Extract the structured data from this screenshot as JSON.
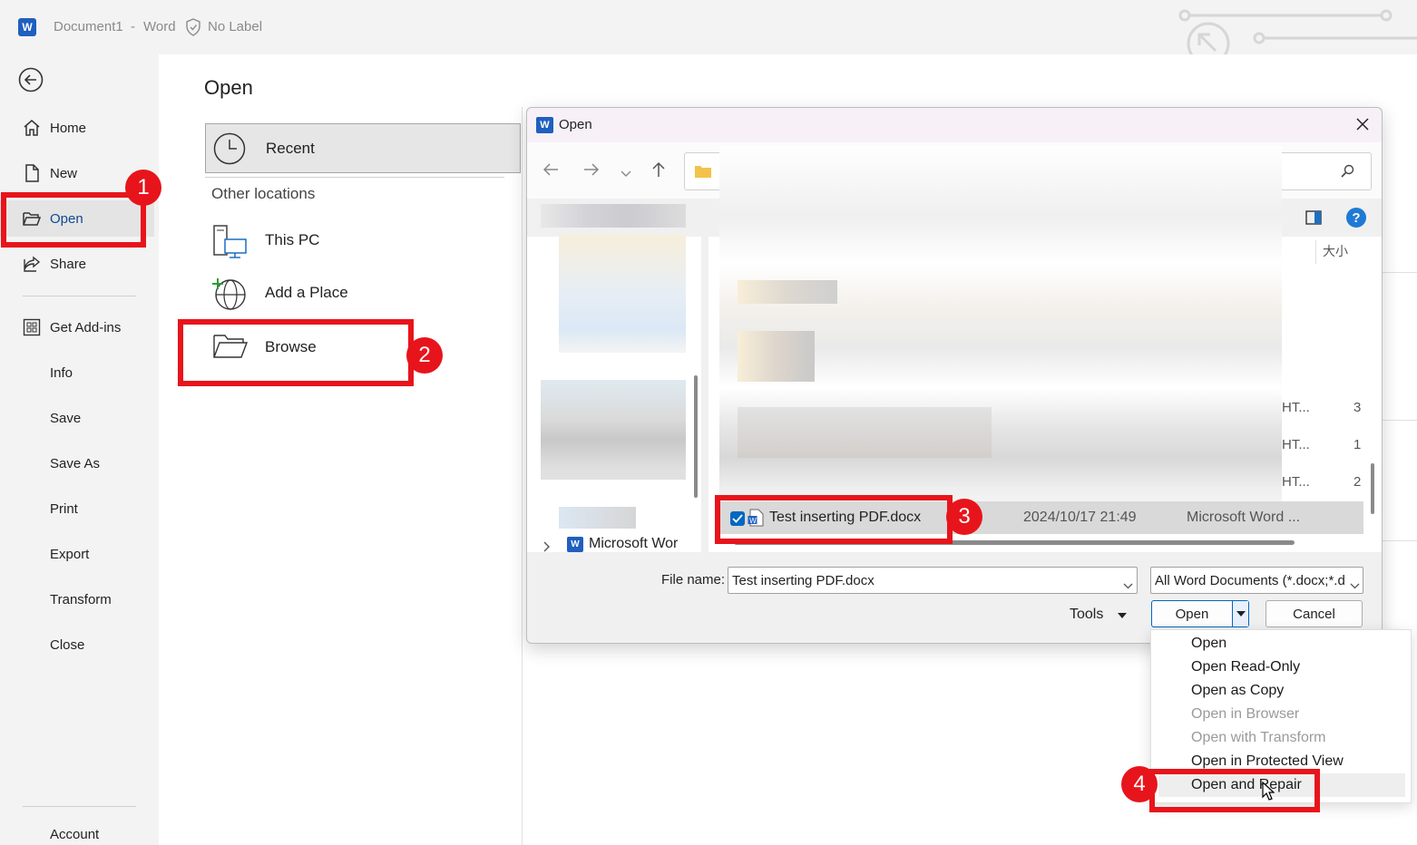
{
  "titlebar": {
    "app_icon": "W",
    "document": "Document1",
    "dash": "-",
    "app": "Word",
    "label": "No Label"
  },
  "nav": {
    "home": "Home",
    "new": "New",
    "open": "Open",
    "share": "Share",
    "addins": "Get Add-ins",
    "info": "Info",
    "save": "Save",
    "save_as": "Save As",
    "print": "Print",
    "export": "Export",
    "transform": "Transform",
    "close": "Close",
    "account": "Account"
  },
  "open_panel": {
    "title": "Open",
    "recent": "Recent",
    "other_locations": "Other locations",
    "this_pc": "This PC",
    "add_place": "Add a Place",
    "browse": "Browse"
  },
  "dialog": {
    "title": "Open",
    "column_size": "大小",
    "tree_item": "Microsoft Wor",
    "partial_type": [
      "HT...",
      "HT...",
      "HT..."
    ],
    "partial_size": [
      "3",
      "1",
      "2"
    ],
    "selected_file": {
      "name": "Test inserting PDF.docx",
      "date": "2024/10/17 21:49",
      "type": "Microsoft Word ..."
    },
    "file_name_label": "File name:",
    "file_name_value": "Test inserting PDF.docx",
    "filter_value": "All Word Documents (*.docx;*.d",
    "tools": "Tools",
    "open_button": "Open",
    "cancel_button": "Cancel"
  },
  "open_menu": {
    "items": [
      "Open",
      "Open Read-Only",
      "Open as Copy",
      "Open in Browser",
      "Open with Transform",
      "Open in Protected View",
      "Open and Repair"
    ]
  },
  "steps": [
    "1",
    "2",
    "3",
    "4"
  ],
  "colors": {
    "highlight": "#e8141b",
    "accent": "#0067c0"
  }
}
